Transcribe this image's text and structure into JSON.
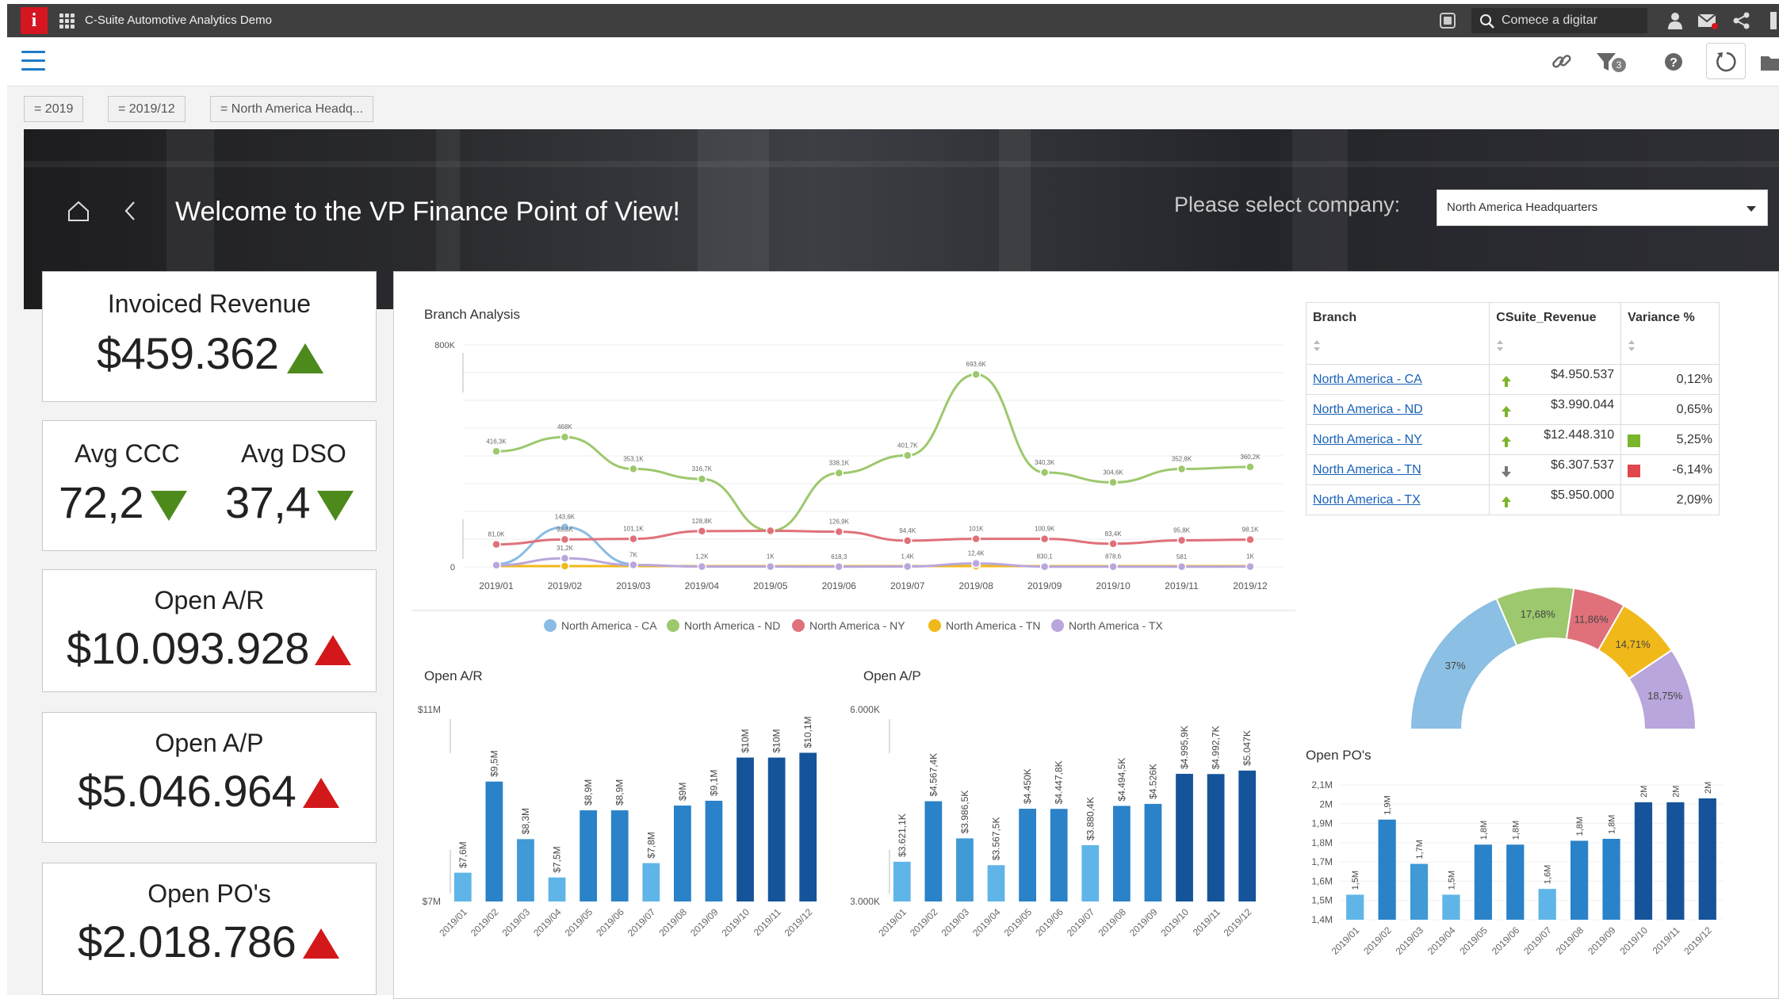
{
  "topbar": {
    "logo_letter": "i",
    "app_title": "C-Suite Automotive Analytics Demo",
    "search_placeholder": "Comece a digitar",
    "icons": [
      "apps-grid-icon",
      "stop-icon",
      "search-icon",
      "user-icon",
      "mail-icon",
      "share-icon"
    ]
  },
  "toolbar": {
    "filter_count": "3",
    "icons": [
      "menu-icon",
      "link-icon",
      "filter-icon",
      "help-icon",
      "refresh-icon",
      "folder-icon"
    ]
  },
  "filter_chips": [
    "= 2019",
    "= 2019/12",
    "= North America Headq..."
  ],
  "hero": {
    "title": "Welcome to the VP Finance Point of View!",
    "company_label": "Please select company:",
    "company_selected": "North America Headquarters"
  },
  "kpis": {
    "invoiced_revenue": {
      "label": "Invoiced Revenue",
      "value": "$459.362",
      "trend": "up",
      "trend_color": "#4d8a1c"
    },
    "avg_ccc": {
      "label": "Avg CCC",
      "value": "72,2",
      "trend": "down",
      "trend_color": "#4d8a1c"
    },
    "avg_dso": {
      "label": "Avg DSO",
      "value": "37,4",
      "trend": "down",
      "trend_color": "#4d8a1c"
    },
    "open_ar": {
      "label": "Open A/R",
      "value": "$10.093.928",
      "trend": "up",
      "trend_color": "#d2181b"
    },
    "open_ap": {
      "label": "Open A/P",
      "value": "$5.046.964",
      "trend": "up",
      "trend_color": "#d2181b"
    },
    "open_po": {
      "label": "Open PO's",
      "value": "$2.018.786",
      "trend": "up",
      "trend_color": "#d2181b"
    }
  },
  "branch_table": {
    "headers": [
      "Branch",
      "CSuite_Revenue",
      "Variance %"
    ],
    "rows": [
      {
        "branch": "North America - CA",
        "arrow": "up",
        "revenue": "$4.950.537",
        "indicator": "",
        "variance": "0,12%"
      },
      {
        "branch": "North America - ND",
        "arrow": "up",
        "revenue": "$3.990.044",
        "indicator": "",
        "variance": "0,65%"
      },
      {
        "branch": "North America - NY",
        "arrow": "up",
        "revenue": "$12.448.310",
        "indicator": "#7bb52b",
        "variance": "5,25%"
      },
      {
        "branch": "North America - TN",
        "arrow": "down",
        "revenue": "$6.307.537",
        "indicator": "#e0474c",
        "variance": "-6,14%"
      },
      {
        "branch": "North America - TX",
        "arrow": "up",
        "revenue": "$5.950.000",
        "indicator": "",
        "variance": "2,09%"
      }
    ]
  },
  "chart_data": [
    {
      "id": "branch-analysis",
      "type": "line",
      "title": "Branch Analysis",
      "x": [
        "2019/01",
        "2019/02",
        "2019/03",
        "2019/04",
        "2019/05",
        "2019/06",
        "2019/07",
        "2019/08",
        "2019/09",
        "2019/10",
        "2019/11",
        "2019/12"
      ],
      "ylim": [
        0,
        800000
      ],
      "y_tick_labels": [
        "0",
        "800K"
      ],
      "legend_position": "bottom",
      "series": [
        {
          "name": "North America - CA",
          "color": "#8bbce3",
          "values": [
            10000,
            143600,
            10000,
            null,
            null,
            null,
            null,
            null,
            null,
            null,
            null,
            null
          ],
          "labels": [
            "",
            "143,6K",
            "",
            "",
            "",
            "",
            "",
            "",
            "",
            "",
            "",
            ""
          ]
        },
        {
          "name": "North America - ND",
          "color": "#9dc86d",
          "values": [
            416300,
            468000,
            353100,
            316700,
            130000,
            338100,
            401700,
            693600,
            340300,
            304600,
            352800,
            360200
          ],
          "labels": [
            "416,3K",
            "468K",
            "353,1K",
            "316,7K",
            "",
            "338,1K",
            "401,7K",
            "693,6K",
            "340,3K",
            "304,6K",
            "352,8K",
            "360,2K"
          ]
        },
        {
          "name": "North America - NY",
          "color": "#e0717a",
          "values": [
            81000,
            98800,
            101100,
            128800,
            130000,
            126900,
            94400,
            101000,
            100900,
            83400,
            95800,
            98100
          ],
          "labels": [
            "81,0K",
            "98,8K",
            "101,1K",
            "128,8K",
            "",
            "126,9K",
            "94,4K",
            "101K",
            "100,9K",
            "83,4K",
            "95,8K",
            "98,1K"
          ]
        },
        {
          "name": "North America - TN",
          "color": "#f1b81a",
          "values": [
            3000,
            3000,
            3000,
            3000,
            3000,
            3000,
            3000,
            3000,
            3000,
            3000,
            3000,
            3000
          ],
          "labels": [
            "",
            "",
            "",
            "",
            "",
            "",
            "",
            "",
            "",
            "",
            "",
            ""
          ]
        },
        {
          "name": "North America - TX",
          "color": "#b9a6dc",
          "values": [
            6000,
            31200,
            7000,
            1200,
            1000,
            618.3,
            1400,
            12400,
            830.1,
            878.6,
            581,
            1000
          ],
          "labels": [
            "",
            "31,2K",
            "7K",
            "1,2K",
            "1K",
            "618,3",
            "1,4K",
            "12,4K",
            "830,1",
            "878,6",
            "581",
            "1K"
          ]
        }
      ]
    },
    {
      "id": "open-ar",
      "type": "bar",
      "title": "Open A/R",
      "categories": [
        "2019/01",
        "2019/02",
        "2019/03",
        "2019/04",
        "2019/05",
        "2019/06",
        "2019/07",
        "2019/08",
        "2019/09",
        "2019/10",
        "2019/11",
        "2019/12"
      ],
      "values": [
        7.6,
        9.5,
        8.3,
        7.5,
        8.9,
        8.9,
        7.8,
        9.0,
        9.1,
        10.0,
        10.0,
        10.1
      ],
      "labels": [
        "$7,6M",
        "$9,5M",
        "$8,3M",
        "$7,5M",
        "$8,9M",
        "$8,9M",
        "$7,8M",
        "$9M",
        "$9,1M",
        "$10M",
        "$10M",
        "$10,1M"
      ],
      "colors": [
        "#5fb5e8",
        "#2a82c8",
        "#3f9ad6",
        "#5fb5e8",
        "#2a82c8",
        "#2a82c8",
        "#5fb5e8",
        "#2a82c8",
        "#2a82c8",
        "#15549a",
        "#15549a",
        "#15549a"
      ],
      "ylim": [
        7,
        11
      ],
      "y_tick_labels": [
        "$7M",
        "$11M"
      ]
    },
    {
      "id": "open-ap",
      "type": "bar",
      "title": "Open A/P",
      "categories": [
        "2019/01",
        "2019/02",
        "2019/03",
        "2019/04",
        "2019/05",
        "2019/06",
        "2019/07",
        "2019/08",
        "2019/09",
        "2019/10",
        "2019/11",
        "2019/12"
      ],
      "values": [
        3621.1,
        4567.4,
        3986.5,
        3567.5,
        4450,
        4447.8,
        3880.4,
        4494.5,
        4526,
        4995.9,
        4992.7,
        5047
      ],
      "labels": [
        "$3.621,1K",
        "$4.567,4K",
        "$3.986,5K",
        "$3.567,5K",
        "$4.450K",
        "$4.447,8K",
        "$3.880,4K",
        "$4.494,5K",
        "$4.526K",
        "$4.995,9K",
        "$4.992,7K",
        "$5.047K"
      ],
      "colors": [
        "#5fb5e8",
        "#2a82c8",
        "#3f9ad6",
        "#5fb5e8",
        "#2a82c8",
        "#2a82c8",
        "#5fb5e8",
        "#2a82c8",
        "#2a82c8",
        "#15549a",
        "#15549a",
        "#15549a"
      ],
      "ylim": [
        3000,
        6000
      ],
      "y_tick_labels": [
        "$3.000K",
        "$6.000K"
      ]
    },
    {
      "id": "revenue-share",
      "type": "pie",
      "style": "semi-donut",
      "slices": [
        {
          "label": "37%",
          "value": 37,
          "color": "#8bbfe3"
        },
        {
          "label": "17,68%",
          "value": 17.68,
          "color": "#9dc86d"
        },
        {
          "label": "11,86%",
          "value": 11.86,
          "color": "#e0717a"
        },
        {
          "label": "14,71%",
          "value": 14.71,
          "color": "#f1b81a"
        },
        {
          "label": "18,75%",
          "value": 18.75,
          "color": "#b9a6dc"
        }
      ]
    },
    {
      "id": "open-pos",
      "type": "bar",
      "title": "Open PO's",
      "categories": [
        "2019/01",
        "2019/02",
        "2019/03",
        "2019/04",
        "2019/05",
        "2019/06",
        "2019/07",
        "2019/08",
        "2019/09",
        "2019/10",
        "2019/11",
        "2019/12"
      ],
      "values": [
        1.53,
        1.92,
        1.69,
        1.53,
        1.79,
        1.79,
        1.56,
        1.81,
        1.82,
        2.01,
        2.01,
        2.03
      ],
      "labels": [
        "1,5M",
        "1,9M",
        "1,7M",
        "1,5M",
        "1,8M",
        "1,8M",
        "1,6M",
        "1,8M",
        "1,8M",
        "2M",
        "2M",
        "2M"
      ],
      "colors": [
        "#5fb5e8",
        "#2a82c8",
        "#3f9ad6",
        "#5fb5e8",
        "#2a82c8",
        "#2a82c8",
        "#5fb5e8",
        "#2a82c8",
        "#2a82c8",
        "#15549a",
        "#15549a",
        "#15549a"
      ],
      "ylim": [
        1.4,
        2.1
      ],
      "y_ticks": [
        1.4,
        1.5,
        1.6,
        1.7,
        1.8,
        1.9,
        2.0,
        2.1
      ],
      "y_tick_labels": [
        "1,4M",
        "1,5M",
        "1,6M",
        "1,7M",
        "1,8M",
        "1,9M",
        "2M",
        "2,1M"
      ]
    }
  ]
}
